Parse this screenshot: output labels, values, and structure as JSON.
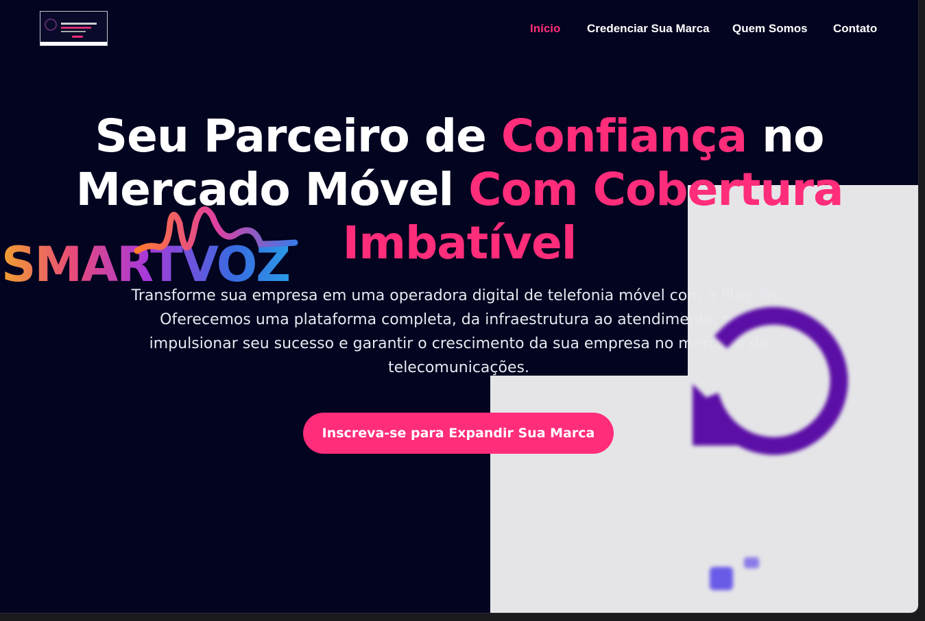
{
  "nav": {
    "items": [
      {
        "label": "Início",
        "active": true
      },
      {
        "label": "Credenciar Sua Marca",
        "active": false
      },
      {
        "label": "Quem Somos",
        "active": false
      },
      {
        "label": "Contato",
        "active": false
      }
    ]
  },
  "logo": {
    "name": "site-logo",
    "icon": "thumbnail-logo"
  },
  "hero": {
    "title_part1": "Seu Parceiro de ",
    "title_highlight1": "Confiança",
    "title_part2": " no",
    "title_part3": "Mercado Móvel ",
    "title_highlight2": "Com Cobertura",
    "title_highlight3": "Imbatível",
    "description": "Transforme sua empresa em uma operadora digital de telefonia móvel com a Play Tec. Oferecemos uma plataforma completa, da infraestrutura ao atendimento, para impulsionar seu sucesso e garantir o crescimento da sua empresa no mercado de telecomunicações.",
    "cta_label": "Inscreva-se para Expandir Sua Marca"
  },
  "brand_overlay": {
    "text": "SMARTVOZ"
  },
  "colors": {
    "background": "#020420",
    "accent": "#ff2d7a",
    "panel": "#e5e5e8",
    "reload": "#5b0fa6"
  }
}
